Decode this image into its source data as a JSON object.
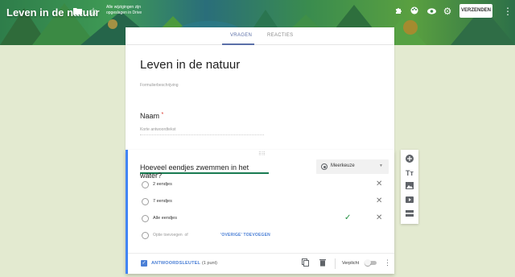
{
  "header": {
    "title": "Leven in de natuur",
    "saved_note": "Alle wijzigingen zijn opgeslagen in Drive",
    "send_label": "VERZENDEN",
    "icons": [
      "folder-icon",
      "star-icon",
      "puzzle-icon",
      "palette-icon",
      "eye-icon",
      "gear-icon",
      "more-vert-icon"
    ]
  },
  "tabs": [
    {
      "label": "VRAGEN",
      "active": true
    },
    {
      "label": "REACTIES",
      "active": false
    }
  ],
  "form": {
    "title": "Leven in de natuur",
    "description_placeholder": "Formulierbeschrijving",
    "question1": {
      "label": "Naam",
      "required_mark": "*",
      "hint": "Korte antwoordtekst"
    }
  },
  "question": {
    "title": "Hoeveel eendjes zwemmen in het water?",
    "type": "Meerkeuze",
    "options": [
      {
        "label": "2 eendjes",
        "correct": false
      },
      {
        "label": "7 eendjes",
        "correct": false
      },
      {
        "label": "Alle eendjes",
        "correct": true
      }
    ],
    "add_option": "Optie toevoegen",
    "or": "of",
    "add_other": "'OVERIGE' TOEVOEGEN",
    "answer_key": "ANTWOORDSLEUTEL",
    "points": "(1 punt)",
    "required_label": "Verplicht"
  },
  "colors": {
    "accent": "#4285f4",
    "correct": "#1e8e3e",
    "background": "#e3ead0"
  }
}
